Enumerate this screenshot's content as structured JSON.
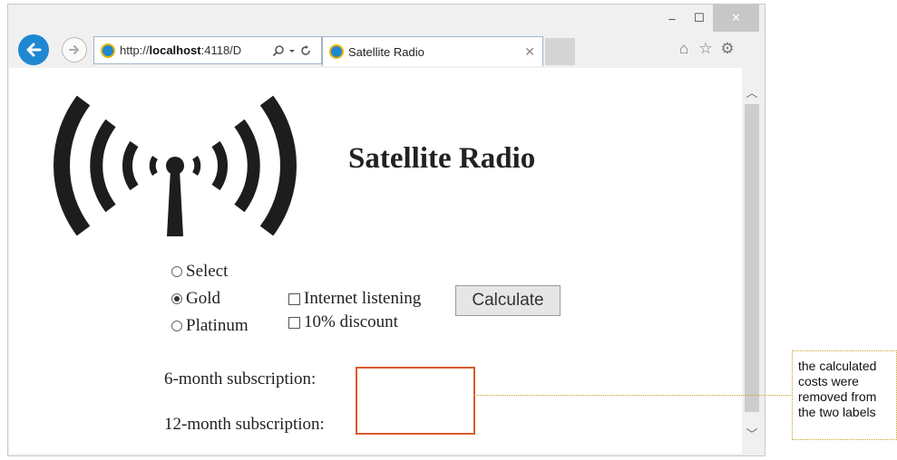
{
  "browser": {
    "address_url_prefix": "http://",
    "address_url_host": "localhost",
    "address_url_rest": ":4118/D",
    "tab_title": "Satellite Radio",
    "window_controls": {
      "minimize": "–",
      "maximize": "☐",
      "close": "✕"
    },
    "icons": [
      "back-arrow-icon",
      "forward-arrow-icon",
      "ie-logo-icon",
      "search-icon",
      "dropdown-icon",
      "refresh-icon",
      "home-icon",
      "favorites-star-icon",
      "settings-gear-icon"
    ]
  },
  "page": {
    "title": "Satellite Radio",
    "radios": [
      {
        "label": "Select",
        "checked": false
      },
      {
        "label": "Gold",
        "checked": true
      },
      {
        "label": "Platinum",
        "checked": false
      }
    ],
    "checkboxes": [
      {
        "label": "Internet listening",
        "checked": false
      },
      {
        "label": "10% discount",
        "checked": false
      }
    ],
    "calculate_label": "Calculate",
    "six_month_label": "6-month subscription:",
    "twelve_month_label": "12-month subscription:"
  },
  "annotation": {
    "lines": [
      "the calculated",
      "costs were",
      "removed from",
      "the two labels"
    ],
    "color": "#c9a227",
    "highlight_color": "#d95b2d"
  }
}
